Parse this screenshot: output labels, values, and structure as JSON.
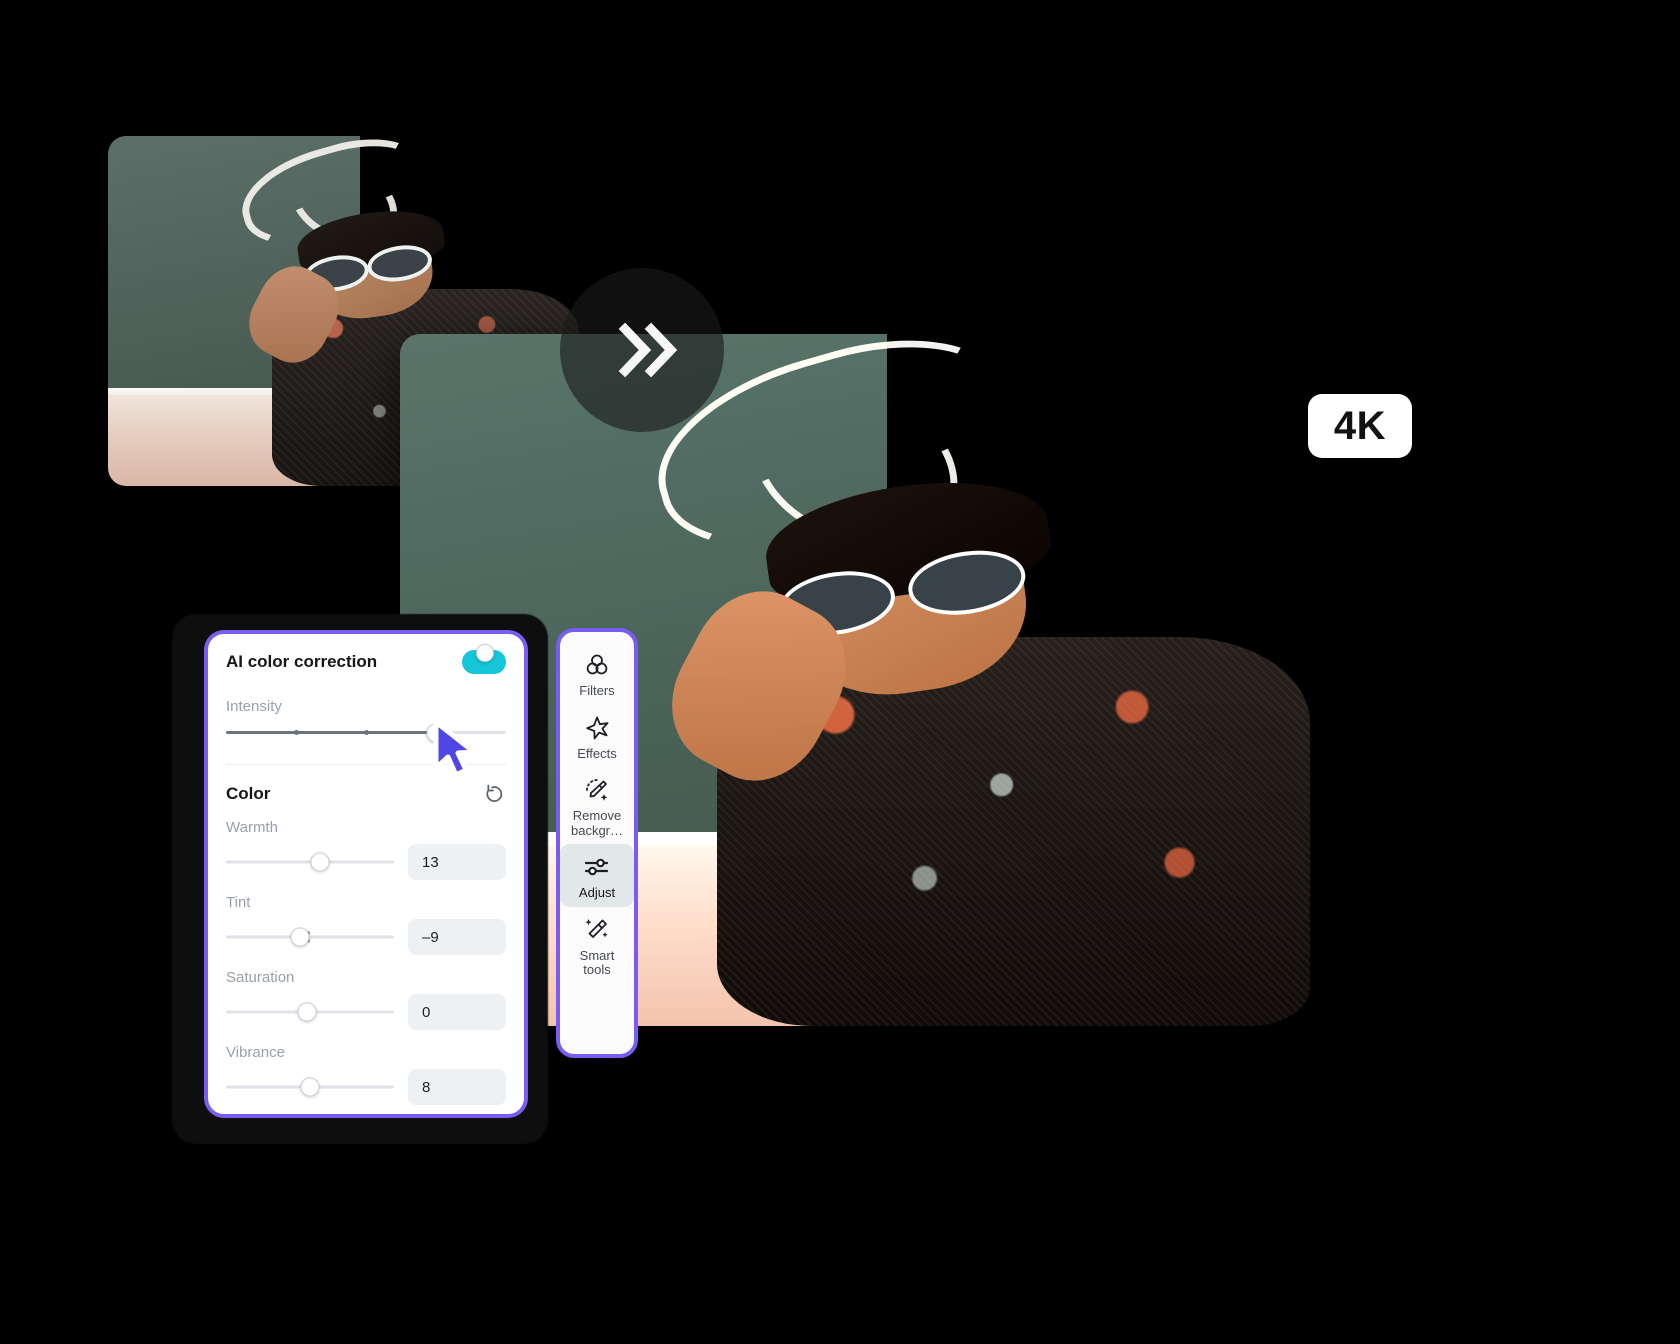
{
  "app": {
    "before_image_alt": "Original photo of woman in sunglasses and lace top in front of teal wall",
    "after_image_alt": "Enhanced 4K photo of woman in sunglasses and lace top in front of teal wall",
    "compare_icon": "double-chevron-right-icon",
    "quality_badge": "4K"
  },
  "panel": {
    "title": "AI color correction",
    "toggle_state": "on",
    "toggle_color": "#16c5d8",
    "accent_color": "#7a5cf0",
    "intensity": {
      "label": "Intensity",
      "value_percent": 75,
      "ticks_percent": [
        25,
        50
      ]
    },
    "color_section": {
      "title": "Color",
      "reset_icon": "reset-rotate-icon",
      "sliders": [
        {
          "label": "Warmth",
          "value": "13",
          "position_percent": 56,
          "notch_percent": 52
        },
        {
          "label": "Tint",
          "value": "-9",
          "position_percent": 44,
          "notch_percent": 49
        },
        {
          "label": "Saturation",
          "value": "0",
          "position_percent": 48,
          "notch_percent": 48
        },
        {
          "label": "Vibrance",
          "value": "8",
          "position_percent": 50,
          "notch_percent": 50
        }
      ]
    }
  },
  "cursor": {
    "name": "mouse-pointer",
    "color": "#4f46e5"
  },
  "toolbar": {
    "items": [
      {
        "label": "Filters",
        "icon": "three-circles-icon",
        "active": false
      },
      {
        "label": "Effects",
        "icon": "sparkle-star-icon",
        "active": false
      },
      {
        "label": "Remove\nbackgr…",
        "icon": "magic-eraser-icon",
        "active": false
      },
      {
        "label": "Adjust",
        "icon": "sliders-icon",
        "active": true
      },
      {
        "label": "Smart\ntools",
        "icon": "magic-wand-icon",
        "active": false
      }
    ]
  }
}
